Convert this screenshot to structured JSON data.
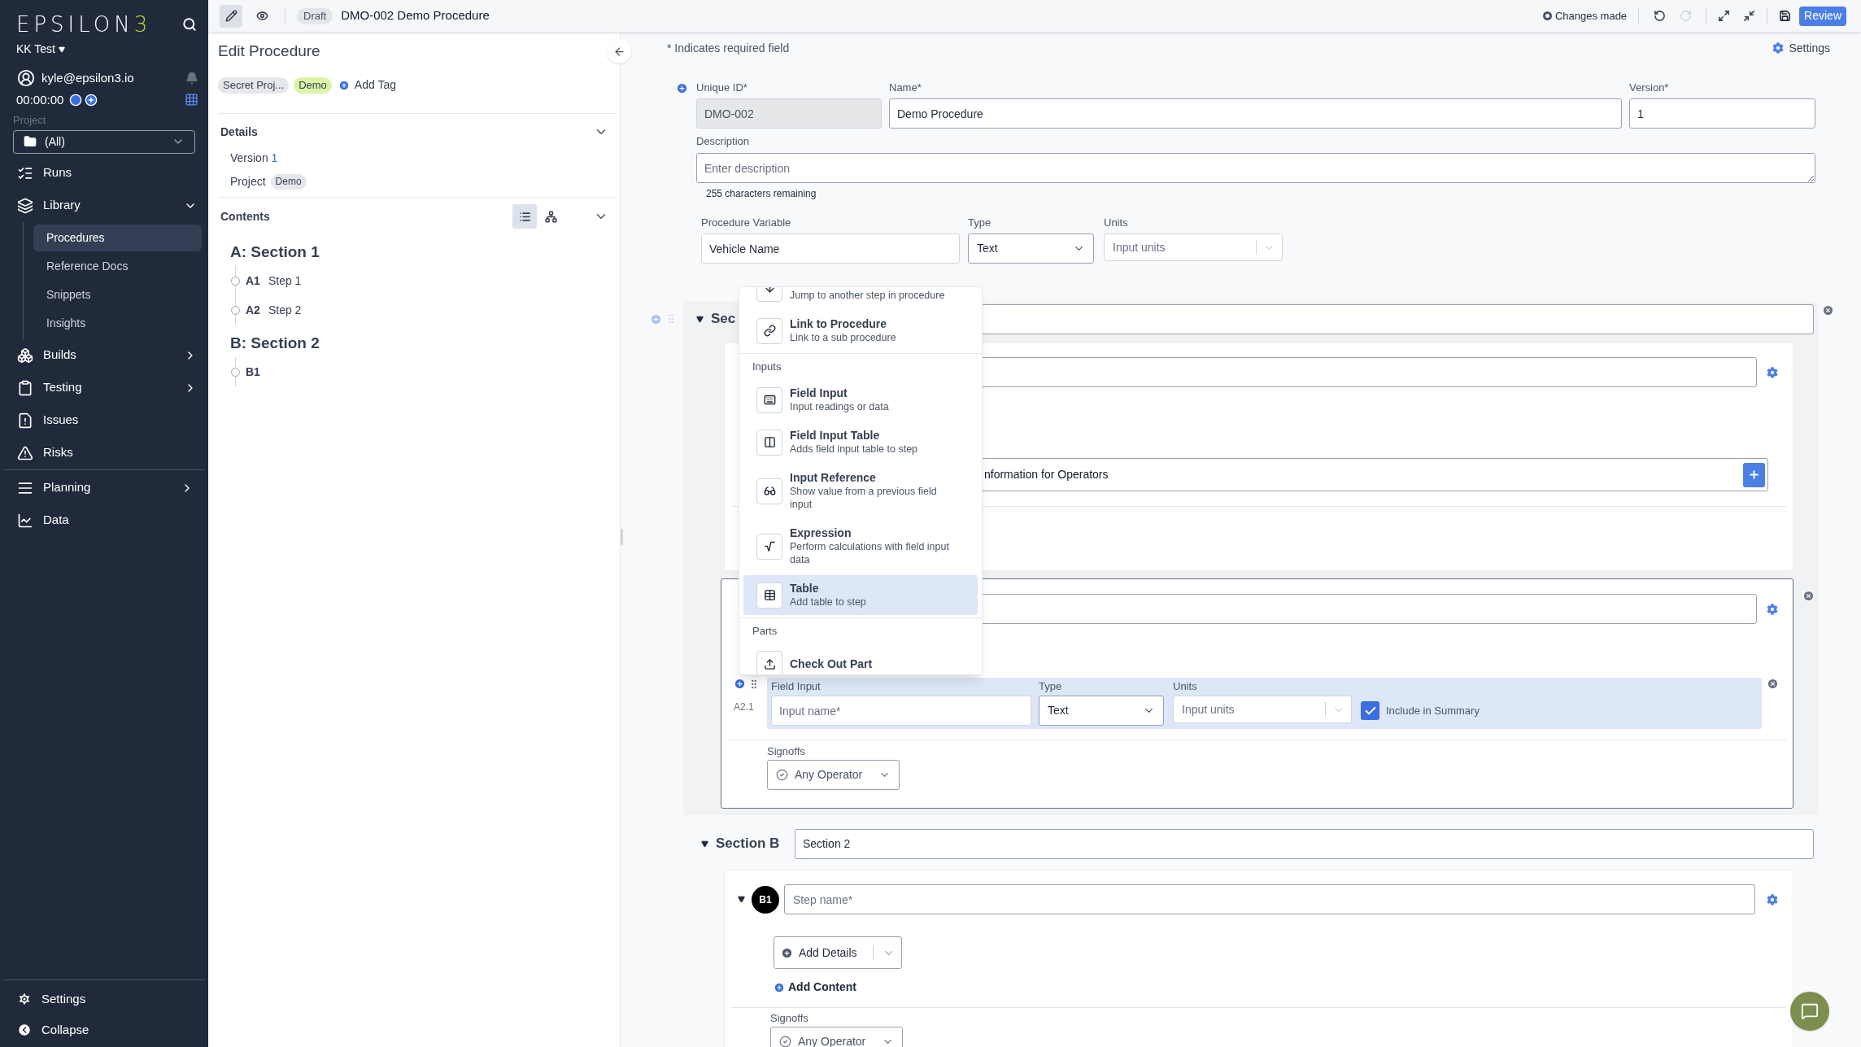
{
  "sidebar": {
    "logo": {
      "text": "EPSILON",
      "accent": "3"
    },
    "workspace": "KK Test",
    "user": "kyle@epsilon3.io",
    "timer": "00:00:00",
    "project_label": "Project",
    "project": "(All)",
    "nav_groups": [
      {
        "items": [
          {
            "label": "Runs"
          },
          {
            "label": "Library",
            "expanded": true,
            "children": [
              {
                "label": "Procedures",
                "selected": true
              },
              {
                "label": "Reference Docs",
                "selected": false
              },
              {
                "label": "Snippets",
                "selected": false
              },
              {
                "label": "Insights",
                "selected": false
              }
            ]
          },
          {
            "label": "Builds",
            "expanded": false
          },
          {
            "label": "Testing",
            "expanded": false
          },
          {
            "label": "Issues"
          },
          {
            "label": "Risks"
          }
        ]
      },
      {
        "items": [
          {
            "label": "Planning",
            "expanded": false
          },
          {
            "label": "Data"
          }
        ]
      }
    ],
    "footer": [
      {
        "label": "Settings"
      },
      {
        "label": "Collapse"
      }
    ]
  },
  "toolbar": {
    "modes": [
      {
        "selected": true
      },
      {
        "selected": false
      }
    ],
    "status": "Draft",
    "title": "DMO-002 Demo Procedure",
    "changes": "Changes made",
    "history": [
      {
        "disabled": false
      },
      {
        "disabled": true
      }
    ],
    "review": "Review"
  },
  "edit_panel": {
    "title": "Edit Procedure",
    "tags": [
      {
        "label": "Secret Proj...",
        "color": "#e5e7eb"
      },
      {
        "label": "Demo",
        "color": "#d9f5a6"
      }
    ],
    "add_tag": "Add Tag",
    "details": {
      "heading": "Details",
      "expanded": true,
      "version_label": "Version",
      "version": "1",
      "project_label": "Project",
      "project": "Demo"
    },
    "contents": {
      "heading": "Contents",
      "expanded": true,
      "views": [
        {
          "selected": true
        },
        {
          "selected": false
        }
      ],
      "sections": [
        {
          "title": "A: Section 1",
          "steps": [
            {
              "key": "A1",
              "name": "Step 1"
            },
            {
              "key": "A2",
              "name": "Step 2"
            }
          ]
        },
        {
          "title": "B: Section 2",
          "steps": [
            {
              "key": "B1"
            }
          ]
        }
      ]
    }
  },
  "editor": {
    "required_note": "* Indicates required field",
    "settings": "Settings",
    "fields": [
      {
        "label": "Unique ID*",
        "value": "DMO-002",
        "disabled": true
      },
      {
        "label": "Name*",
        "value": "Demo Procedure",
        "disabled": false
      },
      {
        "label": "Version*",
        "value": "1",
        "disabled": false
      }
    ],
    "description": {
      "label": "Description",
      "placeholder": "Enter description",
      "remaining": "255 characters remaining"
    },
    "variable": {
      "label": "Procedure Variable",
      "value": "Vehicle Name",
      "type_label": "Type",
      "type": "Text",
      "units_label": "Units",
      "units_placeholder": "Input units"
    },
    "section_a": {
      "heading": "Sec",
      "expanded": true,
      "step_1": {
        "text_block": "nformation for Operators"
      },
      "step_2": {
        "selected": true,
        "field_input": {
          "label": "Field Input",
          "number": "A2.1",
          "placeholder": "Input name*",
          "type_label": "Type",
          "type": "Text",
          "units_label": "Units",
          "units_placeholder": "Input units",
          "summary_label": "Include in Summary",
          "include_in_summary": true
        },
        "signoffs_label": "Signoffs",
        "signoff": "Any Operator"
      }
    },
    "section_b": {
      "heading": "Section B",
      "title": "Section 2",
      "expanded": true,
      "step": {
        "number": "B1",
        "placeholder": "Step name*",
        "expanded": true,
        "add_details": "Add Details",
        "add_content": "Add Content",
        "signoffs_label": "Signoffs",
        "signoff": "Any Operator"
      }
    }
  },
  "insert_menu": {
    "items": [
      {
        "kind": "option",
        "description": "Jump to another step in procedure",
        "selected": false
      },
      {
        "kind": "option",
        "title": "Link to Procedure",
        "description": "Link to a sub procedure",
        "selected": false
      },
      {
        "kind": "header",
        "label": "Inputs"
      },
      {
        "kind": "option",
        "title": "Field Input",
        "description": "Input readings or data",
        "selected": false
      },
      {
        "kind": "option",
        "title": "Field Input Table",
        "description": "Adds field input table to step",
        "selected": false
      },
      {
        "kind": "option",
        "title": "Input Reference",
        "description": "Show value from a previous field input",
        "selected": false
      },
      {
        "kind": "option",
        "title": "Expression",
        "description": "Perform calculations with field input data",
        "selected": false
      },
      {
        "kind": "option",
        "title": "Table",
        "description": "Add table to step",
        "selected": true
      },
      {
        "kind": "header",
        "label": "Parts"
      },
      {
        "kind": "option",
        "title": "Check Out Part",
        "selected": false
      }
    ]
  }
}
